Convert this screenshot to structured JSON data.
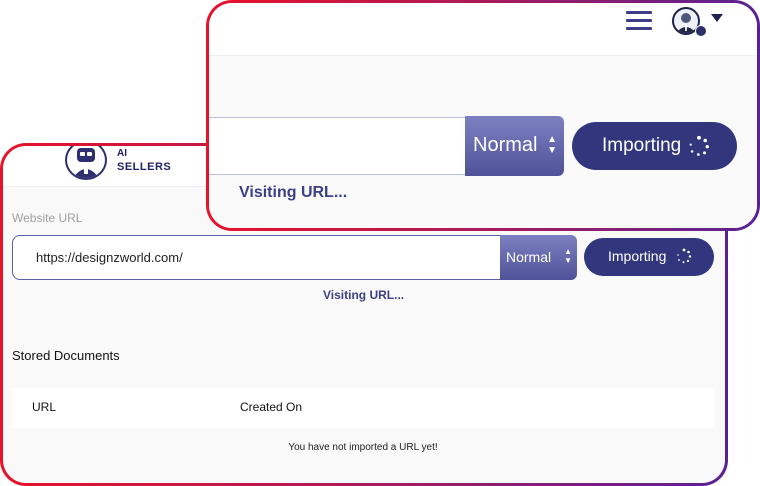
{
  "brand": {
    "line1": "AI",
    "line2": "SELLERS"
  },
  "form": {
    "label": "Website URL",
    "url_value": "https://designzworld.com/",
    "mode_selected": "Normal",
    "import_button": "Importing",
    "status": "Visiting URL..."
  },
  "documents": {
    "title": "Stored Documents",
    "columns": [
      "URL",
      "Created On"
    ],
    "empty_message": "You have not imported a URL yet!"
  },
  "icons": {
    "menu": "hamburger-menu-icon",
    "avatar": "user-avatar-icon",
    "dropdown": "caret-down-icon",
    "spinner": "loading-spinner-icon",
    "select_arrows": "sort-arrows-icon"
  },
  "colors": {
    "accent": "#32367d",
    "select": "#5f63a8",
    "border_start": "#e8122a",
    "border_end": "#5a2194"
  }
}
